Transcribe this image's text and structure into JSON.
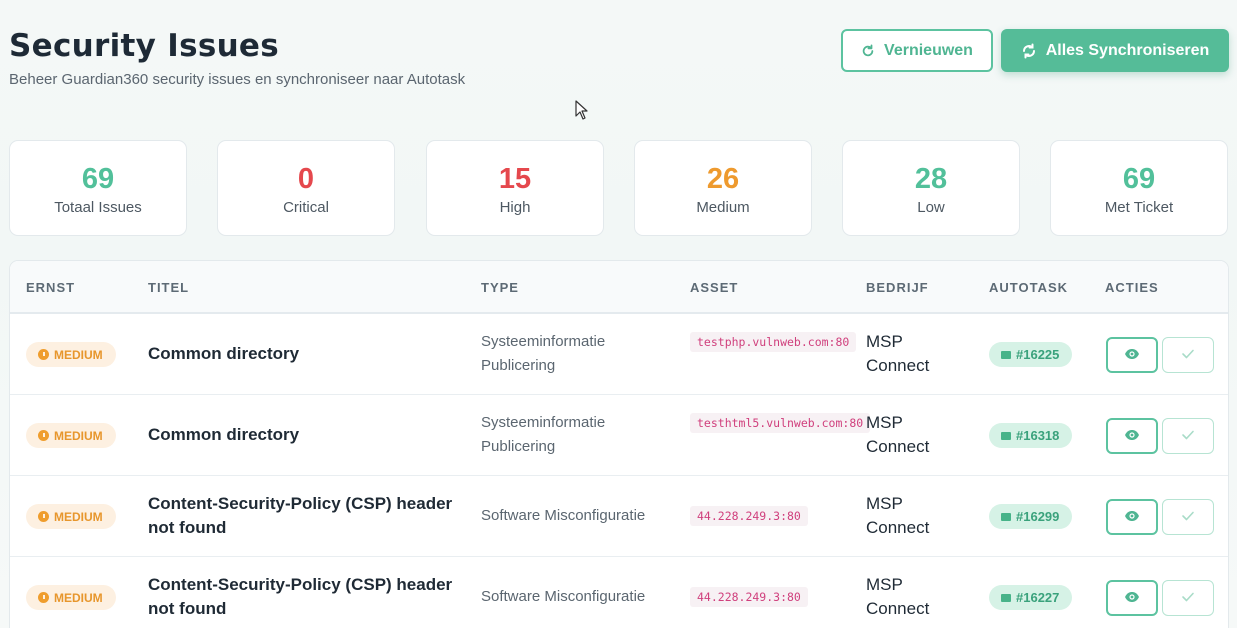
{
  "header": {
    "title": "Security Issues",
    "subtitle": "Beheer Guardian360 security issues en synchroniseer naar Autotask"
  },
  "actions": {
    "refresh_label": "Vernieuwen",
    "sync_label": "Alles Synchroniseren"
  },
  "stats": [
    {
      "value": "69",
      "label": "Totaal Issues",
      "color": "#52c09a"
    },
    {
      "value": "0",
      "label": "Critical",
      "color": "#e5484d"
    },
    {
      "value": "15",
      "label": "High",
      "color": "#e5484d"
    },
    {
      "value": "26",
      "label": "Medium",
      "color": "#ee9a2e"
    },
    {
      "value": "28",
      "label": "Low",
      "color": "#52c09a"
    },
    {
      "value": "69",
      "label": "Met Ticket",
      "color": "#52c09a"
    }
  ],
  "table": {
    "columns": [
      "ERNST",
      "TITEL",
      "TYPE",
      "ASSET",
      "BEDRIJF",
      "AUTOTASK",
      "ACTIES"
    ],
    "rows": [
      {
        "severity": "MEDIUM",
        "title": "Common directory",
        "type": "Systeeminformatie Publicering",
        "asset": "testphp.vulnweb.com:80",
        "company": "MSP Connect",
        "ticket": "#16225"
      },
      {
        "severity": "MEDIUM",
        "title": "Common directory",
        "type": "Systeeminformatie Publicering",
        "asset": "testhtml5.vulnweb.com:80",
        "company": "MSP Connect",
        "ticket": "#16318"
      },
      {
        "severity": "MEDIUM",
        "title": "Content-Security-Policy (CSP) header not found",
        "type": "Software Misconfiguratie",
        "asset": "44.228.249.3:80",
        "company": "MSP Connect",
        "ticket": "#16299"
      },
      {
        "severity": "MEDIUM",
        "title": "Content-Security-Policy (CSP) header not found",
        "type": "Software Misconfiguratie",
        "asset": "44.228.249.3:80",
        "company": "MSP Connect",
        "ticket": "#16227"
      }
    ]
  },
  "icons": {
    "refresh": "refresh-icon",
    "sync": "sync-icon",
    "view": "eye-icon",
    "resolve": "check-icon",
    "ticket": "ticket-icon",
    "severity": "alert-circle-icon"
  },
  "colors": {
    "accent": "#55bc98",
    "severity_medium": "#ee9a2e",
    "critical": "#e5484d"
  }
}
